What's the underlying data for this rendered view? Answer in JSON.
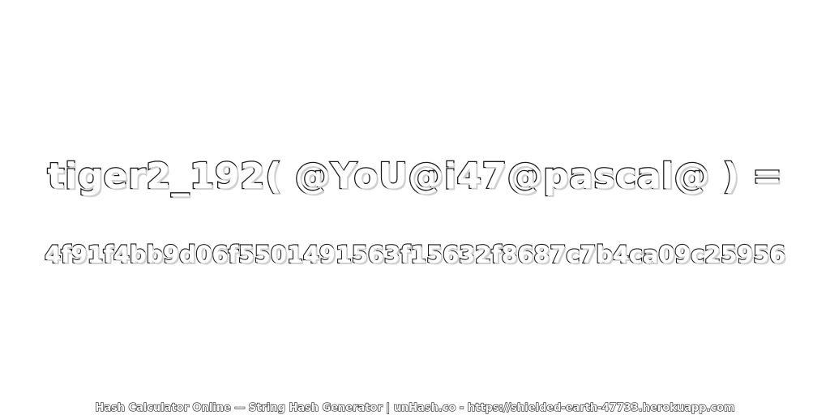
{
  "expression": "tiger2_192( @YoU@i47@pascal@ ) =",
  "hash_value": "4f91f4bb9d06f5501491563f15632f8687c7b4ca09c25956",
  "footer": "Hash Calculator Online — String Hash Generator | unHash.co - https://shielded-earth-47733.herokuapp.com",
  "colors": {
    "background": "#ffffff",
    "text_fill": "#ffffff",
    "text_outline": "#1a1a1a"
  }
}
